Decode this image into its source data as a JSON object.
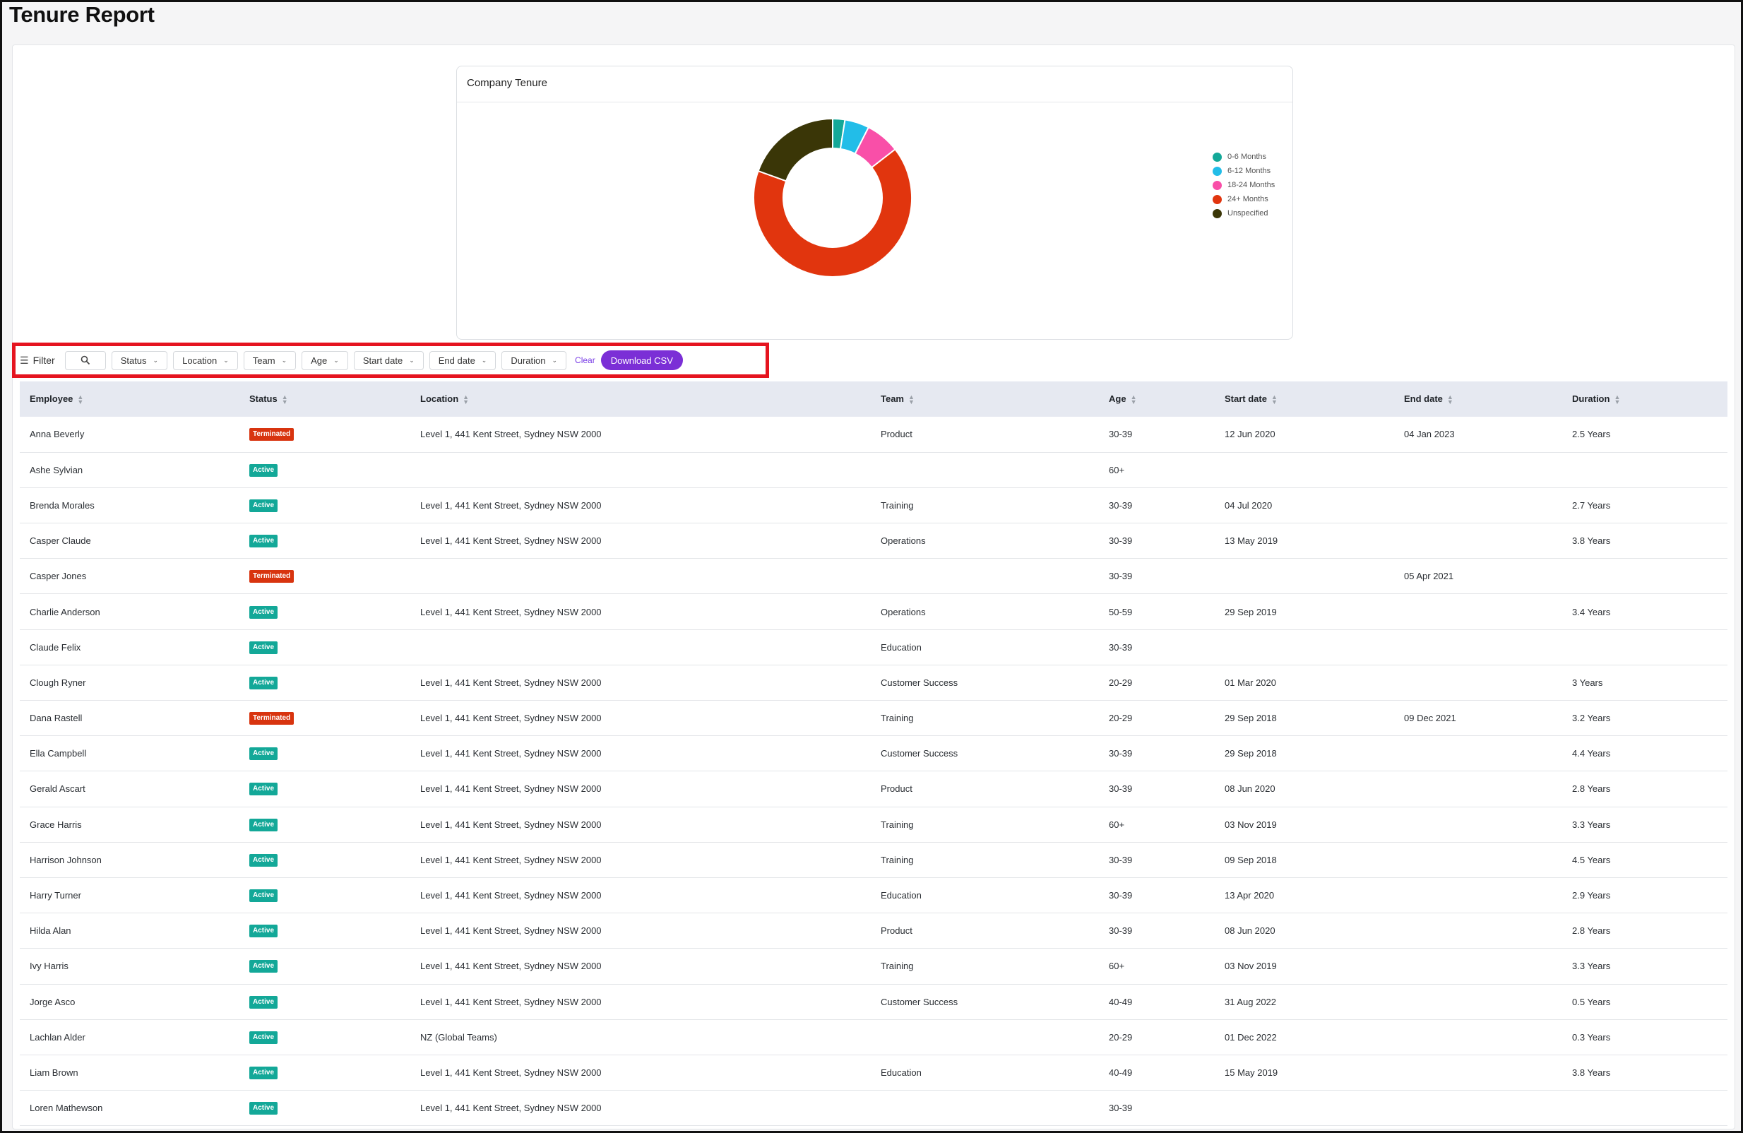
{
  "page": {
    "title": "Tenure Report"
  },
  "chart": {
    "card_title": "Company Tenure"
  },
  "chart_data": {
    "type": "pie",
    "title": "Company Tenure",
    "donut": true,
    "legend_position": "right",
    "slices": [
      {
        "label": "0-6 Months",
        "value": 2.5,
        "color": "#13a898"
      },
      {
        "label": "6-12 Months",
        "value": 5.0,
        "color": "#22bde8"
      },
      {
        "label": "18-24 Months",
        "value": 7.0,
        "color": "#f94fa8"
      },
      {
        "label": "24+ Months",
        "value": 66.0,
        "color": "#e1350e"
      },
      {
        "label": "Unspecified",
        "value": 19.5,
        "color": "#3a3607"
      }
    ]
  },
  "filters": {
    "label": "Filter",
    "buttons": [
      "Status",
      "Location",
      "Team",
      "Age",
      "Start date",
      "End date",
      "Duration"
    ],
    "clear_label": "Clear",
    "download_label": "Download CSV"
  },
  "table": {
    "columns": [
      "Employee",
      "Status",
      "Location",
      "Team",
      "Age",
      "Start date",
      "End date",
      "Duration"
    ],
    "rows": [
      [
        "Anna Beverly",
        "Terminated",
        "Level 1, 441 Kent Street, Sydney NSW 2000",
        "Product",
        "30-39",
        "12 Jun 2020",
        "04 Jan 2023",
        "2.5 Years"
      ],
      [
        "Ashe Sylvian",
        "Active",
        "",
        "",
        "60+",
        "",
        "",
        ""
      ],
      [
        "Brenda Morales",
        "Active",
        "Level 1, 441 Kent Street, Sydney NSW 2000",
        "Training",
        "30-39",
        "04 Jul 2020",
        "",
        "2.7 Years"
      ],
      [
        "Casper Claude",
        "Active",
        "Level 1, 441 Kent Street, Sydney NSW 2000",
        "Operations",
        "30-39",
        "13 May 2019",
        "",
        "3.8 Years"
      ],
      [
        "Casper Jones",
        "Terminated",
        "",
        "",
        "30-39",
        "",
        "05 Apr 2021",
        ""
      ],
      [
        "Charlie Anderson",
        "Active",
        "Level 1, 441 Kent Street, Sydney NSW 2000",
        "Operations",
        "50-59",
        "29 Sep 2019",
        "",
        "3.4 Years"
      ],
      [
        "Claude Felix",
        "Active",
        "",
        "Education",
        "30-39",
        "",
        "",
        ""
      ],
      [
        "Clough Ryner",
        "Active",
        "Level 1, 441 Kent Street, Sydney NSW 2000",
        "Customer Success",
        "20-29",
        "01 Mar 2020",
        "",
        "3 Years"
      ],
      [
        "Dana Rastell",
        "Terminated",
        "Level 1, 441 Kent Street, Sydney NSW 2000",
        "Training",
        "20-29",
        "29 Sep 2018",
        "09 Dec 2021",
        "3.2 Years"
      ],
      [
        "Ella Campbell",
        "Active",
        "Level 1, 441 Kent Street, Sydney NSW 2000",
        "Customer Success",
        "30-39",
        "29 Sep 2018",
        "",
        "4.4 Years"
      ],
      [
        "Gerald Ascart",
        "Active",
        "Level 1, 441 Kent Street, Sydney NSW 2000",
        "Product",
        "30-39",
        "08 Jun 2020",
        "",
        "2.8 Years"
      ],
      [
        "Grace Harris",
        "Active",
        "Level 1, 441 Kent Street, Sydney NSW 2000",
        "Training",
        "60+",
        "03 Nov 2019",
        "",
        "3.3 Years"
      ],
      [
        "Harrison Johnson",
        "Active",
        "Level 1, 441 Kent Street, Sydney NSW 2000",
        "Training",
        "30-39",
        "09 Sep 2018",
        "",
        "4.5 Years"
      ],
      [
        "Harry Turner",
        "Active",
        "Level 1, 441 Kent Street, Sydney NSW 2000",
        "Education",
        "30-39",
        "13 Apr 2020",
        "",
        "2.9 Years"
      ],
      [
        "Hilda Alan",
        "Active",
        "Level 1, 441 Kent Street, Sydney NSW 2000",
        "Product",
        "30-39",
        "08 Jun 2020",
        "",
        "2.8 Years"
      ],
      [
        "Ivy Harris",
        "Active",
        "Level 1, 441 Kent Street, Sydney NSW 2000",
        "Training",
        "60+",
        "03 Nov 2019",
        "",
        "3.3 Years"
      ],
      [
        "Jorge Asco",
        "Active",
        "Level 1, 441 Kent Street, Sydney NSW 2000",
        "Customer Success",
        "40-49",
        "31 Aug 2022",
        "",
        "0.5 Years"
      ],
      [
        "Lachlan Alder",
        "Active",
        "NZ (Global Teams)",
        "",
        "20-29",
        "01 Dec 2022",
        "",
        "0.3 Years"
      ],
      [
        "Liam Brown",
        "Active",
        "Level 1, 441 Kent Street, Sydney NSW 2000",
        "Education",
        "40-49",
        "15 May 2019",
        "",
        "3.8 Years"
      ],
      [
        "Loren Mathewson",
        "Active",
        "Level 1, 441 Kent Street, Sydney NSW 2000",
        "",
        "30-39",
        "",
        "",
        ""
      ]
    ]
  },
  "colors": {
    "brand_purple": "#7b2fd6",
    "active_badge": "#13a898",
    "terminated_badge": "#d8340f",
    "header_row": "#e6e9f1",
    "highlight_border": "#e5141f"
  },
  "icons": {
    "filter": "sliders-icon",
    "search": "search-icon",
    "dropdown": "chevron-down-icon",
    "sort": "sort-icon"
  }
}
